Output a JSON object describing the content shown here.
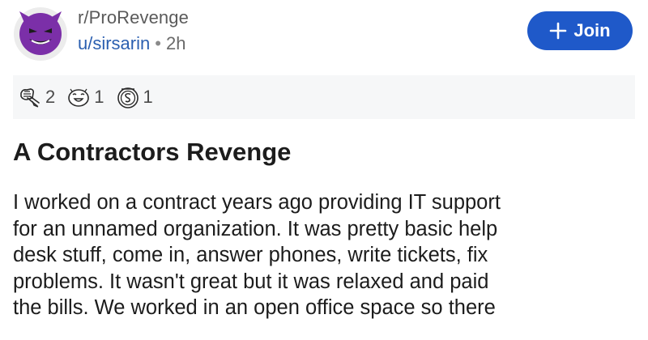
{
  "header": {
    "subreddit": "r/ProRevenge",
    "author": "u/sirsarin",
    "separator": "•",
    "time_ago": "2h",
    "join_label": "Join"
  },
  "awards": [
    {
      "icon": "fist-bump-award-icon",
      "count": "2"
    },
    {
      "icon": "laughing-face-award-icon",
      "count": "1"
    },
    {
      "icon": "silver-coin-award-icon",
      "count": "1"
    }
  ],
  "post": {
    "title": "A Contractors Revenge",
    "body_lines": [
      "I worked on a contract years ago providing IT support",
      "for an unnamed organization. It was pretty basic help",
      "desk stuff, come in, answer phones, write tickets, fix",
      "problems. It wasn't great but it was relaxed and paid",
      "the bills. We worked in an open office space so there"
    ]
  },
  "colors": {
    "join_button": "#1f59c9",
    "author_link": "#2b5fb0",
    "awards_background": "#f6f7f8",
    "avatar_purple": "#7b2fa8"
  }
}
